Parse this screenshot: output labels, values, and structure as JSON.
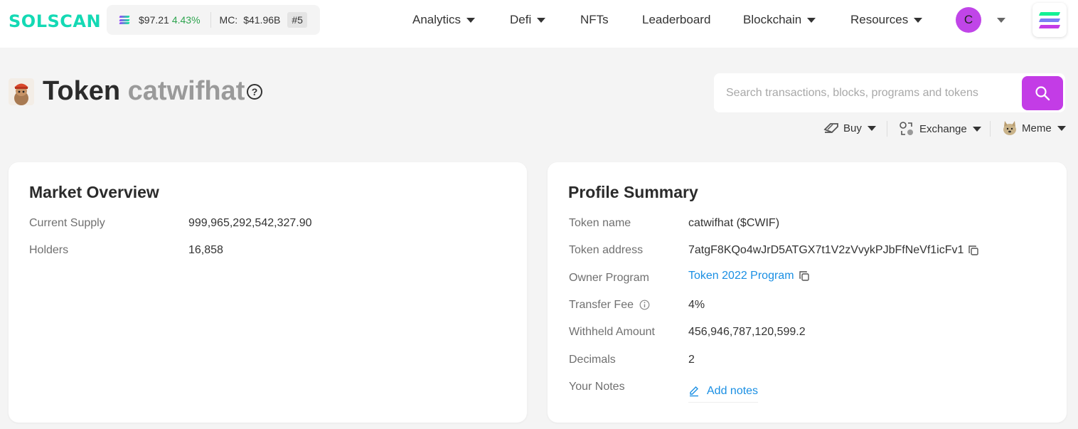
{
  "header": {
    "logo": "SOLSCAN",
    "sol_price": "$97.21",
    "sol_change": "4.43%",
    "mc_label": "MC:",
    "mc_value": "$41.96B",
    "rank": "#5",
    "nav": [
      {
        "label": "Analytics",
        "dropdown": true
      },
      {
        "label": "Defi",
        "dropdown": true
      },
      {
        "label": "NFTs",
        "dropdown": false
      },
      {
        "label": "Leaderboard",
        "dropdown": false
      },
      {
        "label": "Blockchain",
        "dropdown": true
      },
      {
        "label": "Resources",
        "dropdown": true
      }
    ],
    "avatar_letter": "C"
  },
  "page": {
    "title_prefix": "Token",
    "title_name": "catwifhat"
  },
  "search": {
    "placeholder": "Search transactions, blocks, programs and tokens"
  },
  "actions": [
    {
      "label": "Buy",
      "icon": "buy-tag-icon"
    },
    {
      "label": "Exchange",
      "icon": "exchange-icon"
    },
    {
      "label": "Meme",
      "icon": "doge-icon"
    }
  ],
  "market_overview": {
    "title": "Market Overview",
    "rows": [
      {
        "label": "Current Supply",
        "value": "999,965,292,542,327.90"
      },
      {
        "label": "Holders",
        "value": "16,858"
      }
    ]
  },
  "profile_summary": {
    "title": "Profile Summary",
    "token_name_label": "Token name",
    "token_name": "catwifhat ($CWIF)",
    "token_address_label": "Token address",
    "token_address": "7atgF8KQo4wJrD5ATGX7t1V2zVvykPJbFfNeVf1icFv1",
    "owner_program_label": "Owner Program",
    "owner_program": "Token 2022 Program",
    "transfer_fee_label": "Transfer Fee",
    "transfer_fee": "4%",
    "withheld_label": "Withheld Amount",
    "withheld": "456,946,787,120,599.2",
    "decimals_label": "Decimals",
    "decimals": "2",
    "notes_label": "Your Notes",
    "add_notes": "Add notes"
  },
  "colors": {
    "brand": "#14d9b4",
    "accent": "#c33ce6",
    "link": "#1a8fe3",
    "positive": "#2ea44f"
  }
}
